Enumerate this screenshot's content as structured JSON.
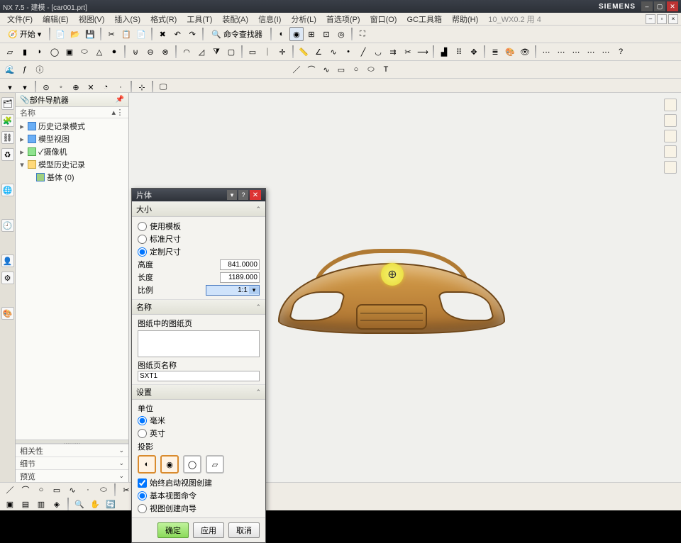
{
  "titlebar": {
    "title": "NX 7.5 - 建模 - [car001.prt]",
    "brand": "SIEMENS"
  },
  "menu": {
    "items": [
      "文件(F)",
      "编辑(E)",
      "视图(V)",
      "插入(S)",
      "格式(R)",
      "工具(T)",
      "装配(A)",
      "信息(I)",
      "分析(L)",
      "首选项(P)",
      "窗口(O)",
      "GC工具箱",
      "帮助(H)"
    ],
    "extra": "10_WX0.2 用 4"
  },
  "toolbar1": {
    "start_label": "开始",
    "find_label": "命令查找器"
  },
  "nav": {
    "title": "部件导航器",
    "col_name": "名称",
    "items": [
      {
        "label": "历史记录模式",
        "icon": "box"
      },
      {
        "label": "模型视图",
        "icon": "box"
      },
      {
        "label": "✓摄像机",
        "icon": "check"
      },
      {
        "label": "模型历史记录",
        "icon": "fold",
        "children": [
          {
            "label": "基体 (0)"
          }
        ]
      }
    ],
    "drops": [
      "相关性",
      "细节",
      "预览"
    ]
  },
  "dialog": {
    "title": "片体",
    "sec_size": "大小",
    "radio_template": "使用模板",
    "radio_standard": "标准尺寸",
    "radio_custom": "定制尺寸",
    "height_label": "高度",
    "height_val": "841.0000",
    "length_label": "长度",
    "length_val": "1189.000",
    "scale_label": "比例",
    "scale_val": "1:1",
    "sec_name": "名称",
    "drawing_name_label": "图纸中的图纸页",
    "sheet_name_label": "图纸页名称",
    "sheet_name_val": "SXT1",
    "sec_settings": "设置",
    "units_label": "单位",
    "unit_mm": "毫米",
    "unit_in": "英寸",
    "proj_label": "投影",
    "auto_start": "始终启动视图创建",
    "base_view": "基本视图命令",
    "view_wizard": "视图创建向导",
    "btn_ok": "确定",
    "btn_apply": "应用",
    "btn_cancel": "取消"
  }
}
